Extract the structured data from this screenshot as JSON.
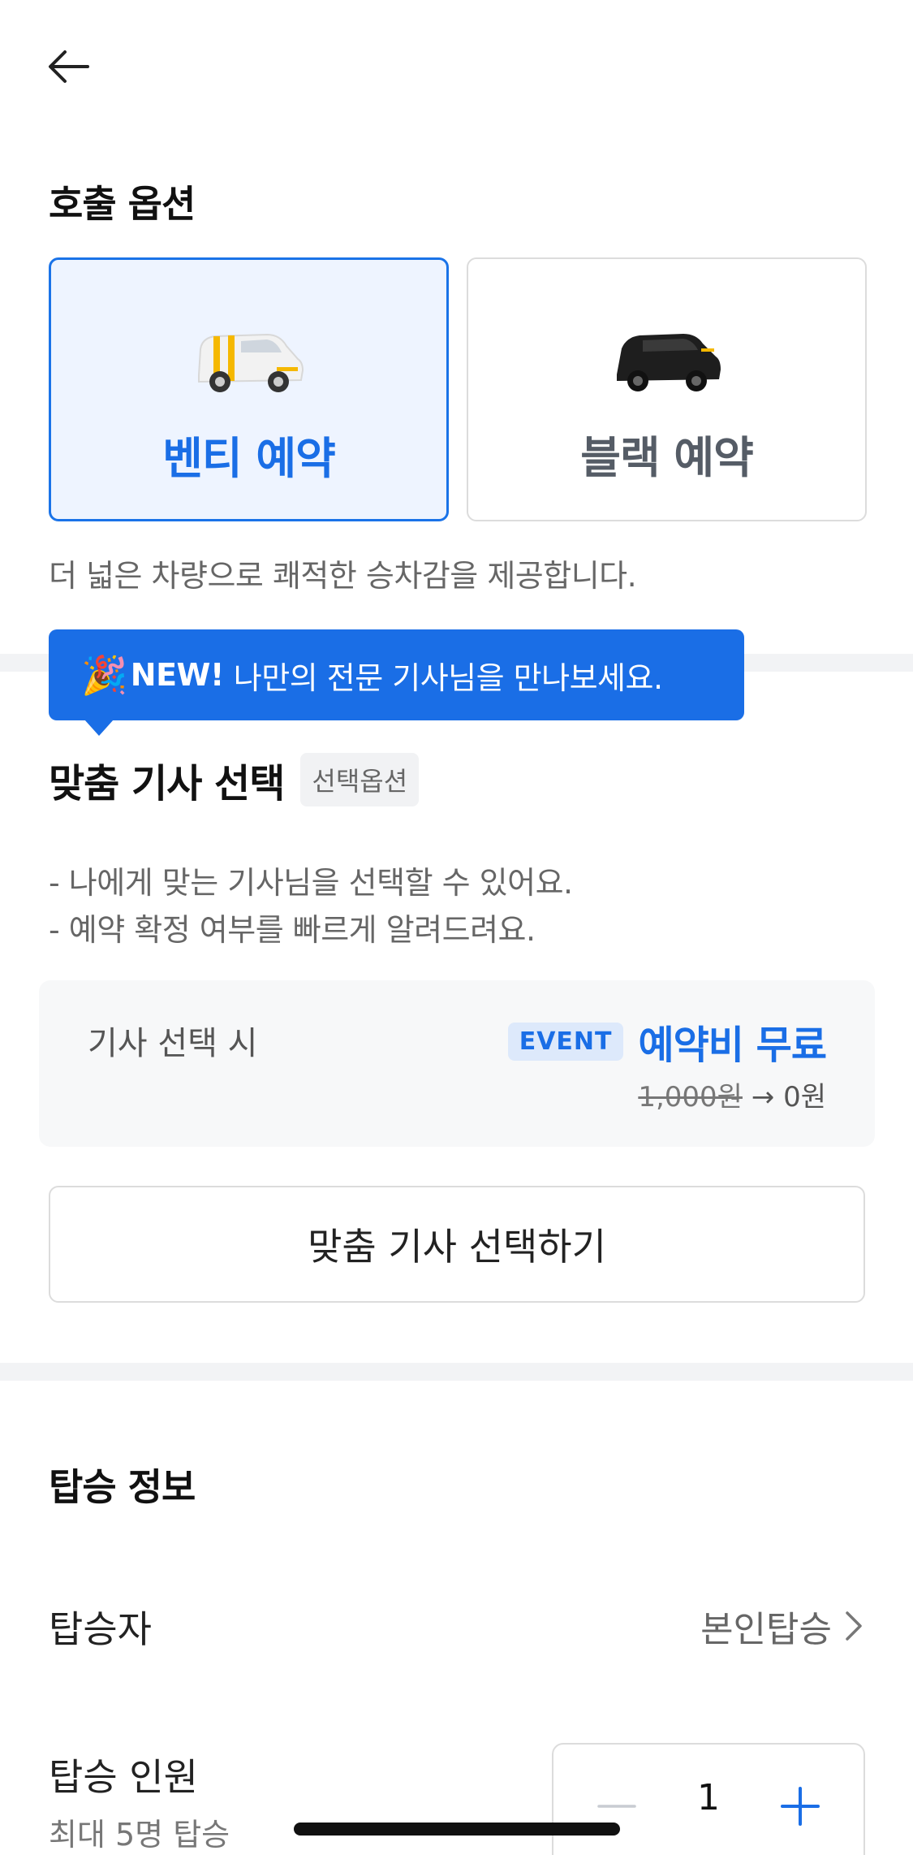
{
  "header": {
    "back_icon": "arrow-left-icon"
  },
  "call_options": {
    "title": "호출 옵션",
    "options": [
      {
        "label": "벤티 예약",
        "selected": true,
        "icon": "white-yellow-van-icon"
      },
      {
        "label": "블랙 예약",
        "selected": false,
        "icon": "black-van-icon"
      }
    ],
    "description": "더 넓은 차량으로 쾌적한 승차감을 제공합니다."
  },
  "banner": {
    "party_emoji": "🎉",
    "new_label": "NEW!",
    "text": "나만의 전문 기사님을 만나보세요."
  },
  "driver_select": {
    "title": "맞춤 기사 선택",
    "chip": "선택옵션",
    "bullets": [
      "- 나에게 맞는 기사님을 선택할 수 있어요.",
      "- 예약 확정 여부를 빠르게 알려드려요."
    ],
    "fee": {
      "left_label": "기사 선택 시",
      "event_badge": "EVENT",
      "free_label": "예약비 무료",
      "old_price": "1,000원",
      "arrow": "→",
      "new_price": "0원"
    },
    "button_label": "맞춤 기사 선택하기"
  },
  "boarding": {
    "title": "탑승 정보",
    "passenger_label": "탑승자",
    "passenger_value": "본인탑승",
    "count_label": "탑승 인원",
    "count_sub": "최대 5명 탑승",
    "count_value": "1"
  },
  "colors": {
    "accent": "#1a6ee6",
    "selected_bg": "#eef4ff",
    "separator": "#f2f3f5"
  }
}
